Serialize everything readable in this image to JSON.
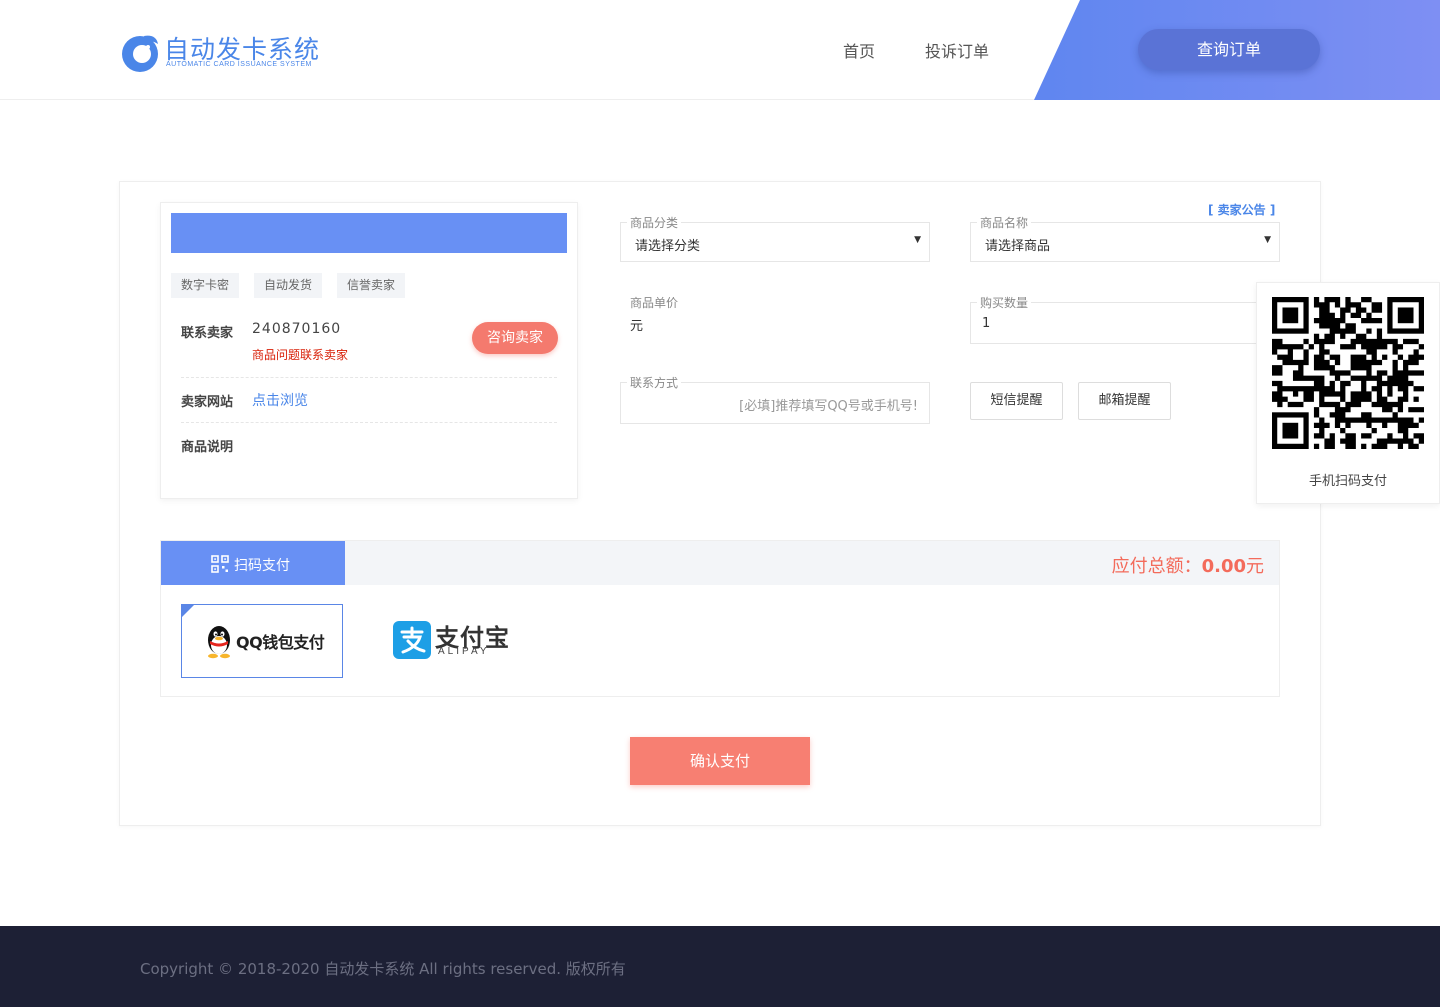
{
  "header": {
    "logo_title": "自动发卡系统",
    "logo_subtitle": "AUTOMATIC CARD ISSUANCE SYSTEM",
    "nav": [
      {
        "label": "首页"
      },
      {
        "label": "投诉订单"
      }
    ],
    "query_button": "查询订单"
  },
  "seller": {
    "tags": [
      "数字卡密",
      "自动发货",
      "信誉卖家"
    ],
    "contact_label": "联系卖家",
    "contact_value": "240870160",
    "contact_hint": "商品问题联系卖家",
    "consult_button": "咨询卖家",
    "site_label": "卖家网站",
    "site_link": "点击浏览",
    "desc_label": "商品说明"
  },
  "form": {
    "category_label": "商品分类",
    "category_value": "请选择分类",
    "name_label": "商品名称",
    "name_value": "请选择商品",
    "notice_link": "[ 卖家公告 ]",
    "price_label": "商品单价",
    "price_value": "元",
    "quantity_label": "购买数量",
    "quantity_value": "1",
    "contact_label": "联系方式",
    "contact_placeholder": "[必填]推荐填写QQ号或手机号!",
    "sms_button": "短信提醒",
    "email_button": "邮箱提醒"
  },
  "qr_panel": {
    "caption": "手机扫码支付"
  },
  "payment": {
    "tab_label": "扫码支付",
    "total_label": "应付总额：",
    "total_amount": "0.00",
    "total_unit": "元",
    "options": [
      {
        "name": "QQ钱包支付"
      },
      {
        "name": "支付宝",
        "sub": "ALIPAY"
      }
    ],
    "confirm_button": "确认支付"
  },
  "footer": {
    "copyright": "Copyright © 2018-2020 自动发卡系统 All rights reserved. 版权所有"
  },
  "colors": {
    "accent_blue": "#6890f4",
    "header_gradient": "#5f86f0",
    "query_button": "#5a73d6",
    "coral": "#f77f72",
    "total_red": "#f36b5b",
    "footer_bg": "#1d2035"
  }
}
